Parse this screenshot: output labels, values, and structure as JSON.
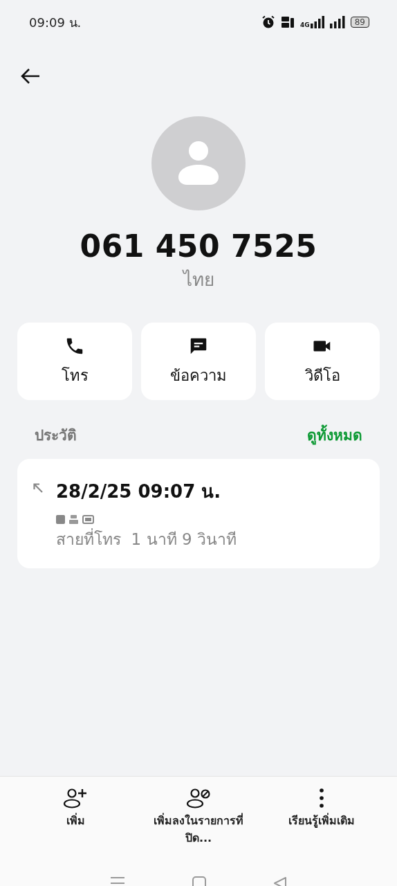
{
  "status_bar": {
    "time": "09:09 น.",
    "network": "4G",
    "battery": "89"
  },
  "contact": {
    "number": "061 450 7525",
    "location": "ไทย"
  },
  "actions": [
    {
      "kind": "call",
      "label": "โทร"
    },
    {
      "kind": "message",
      "label": "ข้อความ"
    },
    {
      "kind": "video",
      "label": "วิดีโอ"
    }
  ],
  "history": {
    "title": "ประวัติ",
    "see_all": "ดูทั้งหมด",
    "entries": [
      {
        "kind": "outgoing",
        "datetime": "28/2/25 09:07 น.",
        "description": "สายที่โทร  1 นาที 9 วินาที"
      }
    ]
  },
  "bottom_actions": [
    {
      "kind": "add",
      "label": "เพิ่ม"
    },
    {
      "kind": "block",
      "label": "เพิ่มลงในรายการที่ปิด..."
    },
    {
      "kind": "more",
      "label": "เรียนรู้เพิ่มเติม"
    }
  ]
}
